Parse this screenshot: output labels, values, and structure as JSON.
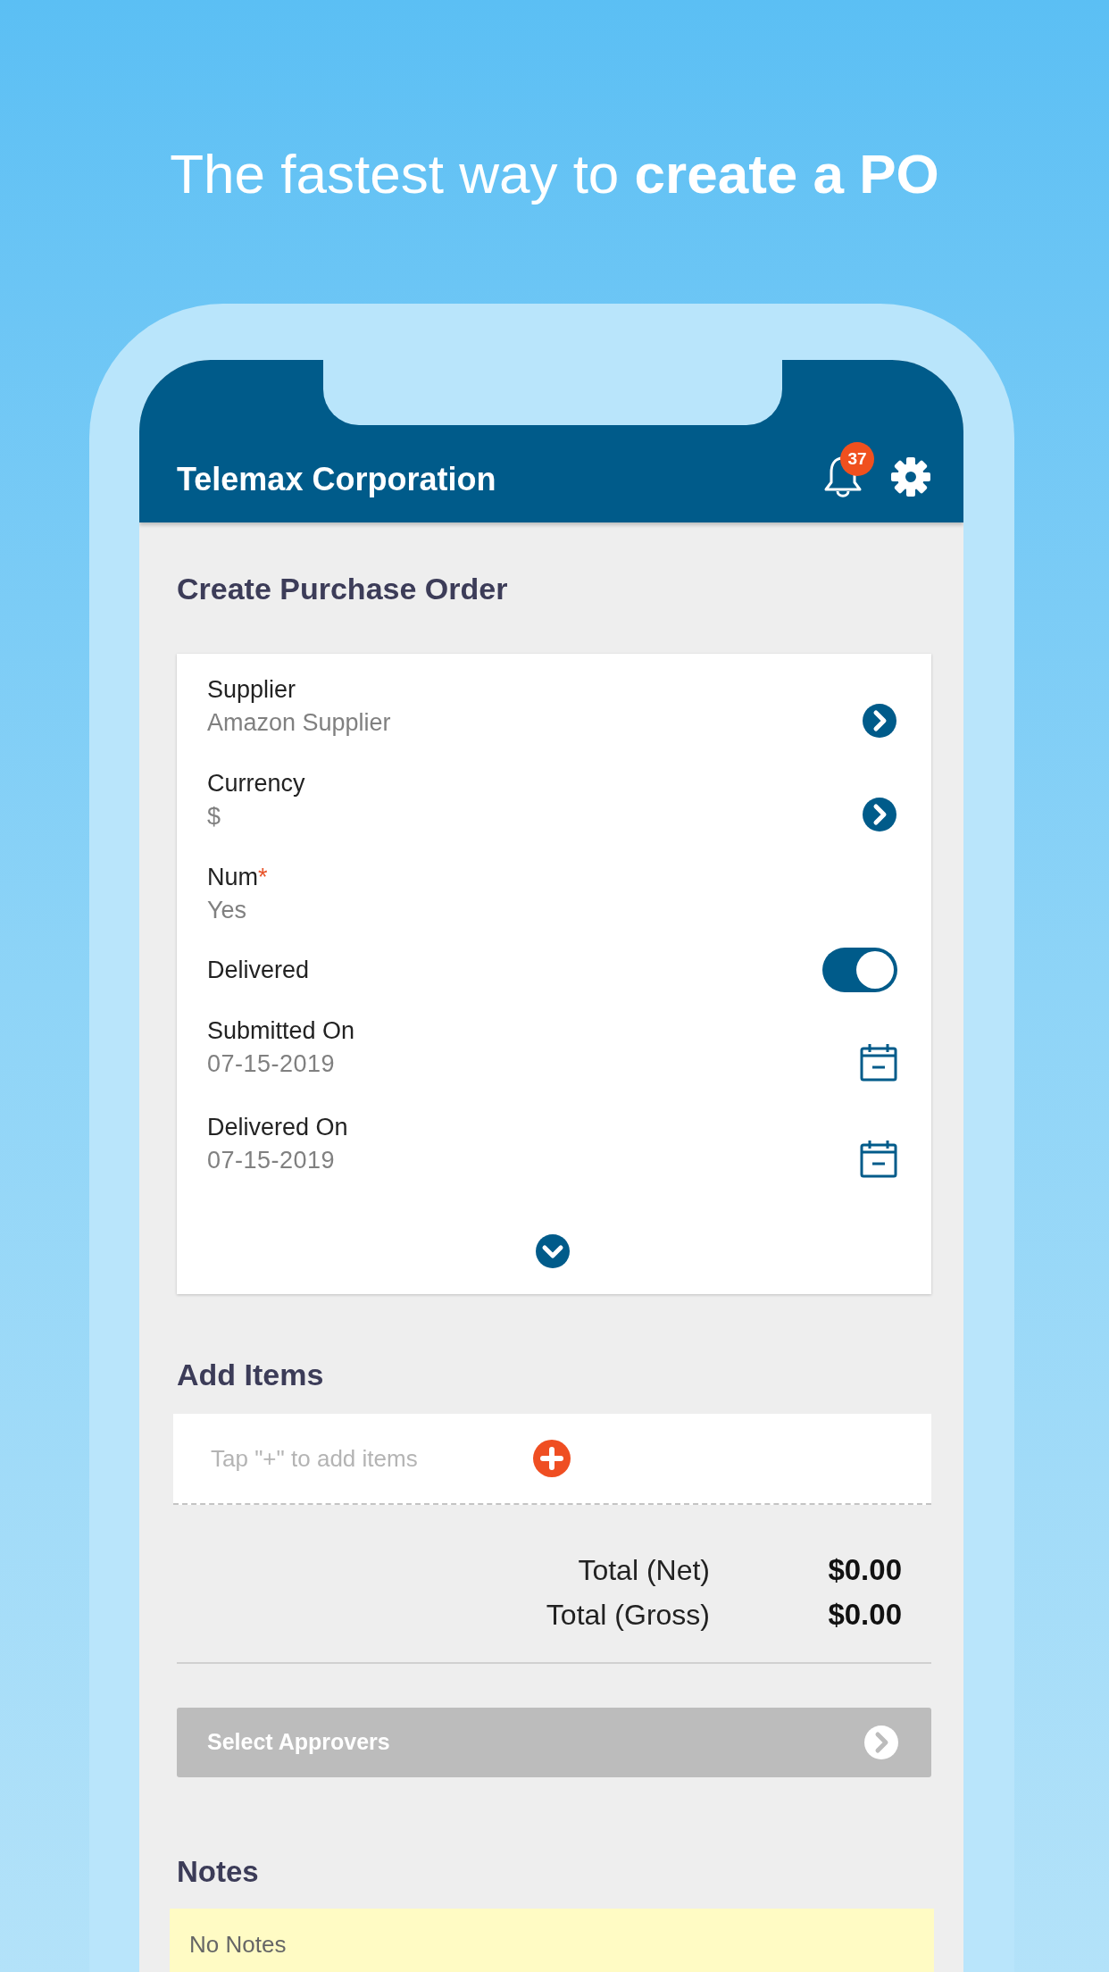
{
  "headline": "The fastest way to **create a PO**",
  "app_bar": {
    "title": "Telemax Corporation",
    "notifications_badge": "37"
  },
  "page_title": "Create Purchase Order",
  "fields": [
    {
      "kind": "link",
      "label": "Supplier",
      "value": "Amazon Supplier"
    },
    {
      "kind": "link",
      "label": "Currency",
      "value": "$"
    },
    {
      "kind": "text",
      "label": "Num",
      "required_mark": "*",
      "value": "Yes"
    },
    {
      "kind": "toggle",
      "label": "Delivered",
      "on": true
    },
    {
      "kind": "date",
      "label": "Submitted On",
      "value": "07-15-2019"
    },
    {
      "kind": "date",
      "label": "Delivered On",
      "value": "07-15-2019"
    }
  ],
  "add_items": {
    "heading": "Add Items",
    "placeholder": "Tap \"+\" to add items"
  },
  "totals": [
    {
      "label": "Total (Net)",
      "value": "$0.00"
    },
    {
      "label": "Total (Gross)",
      "value": "$0.00"
    }
  ],
  "approvers_button": {
    "label": "Select Approvers",
    "disabled": true
  },
  "notes": {
    "heading": "Notes",
    "text": "No Notes"
  }
}
